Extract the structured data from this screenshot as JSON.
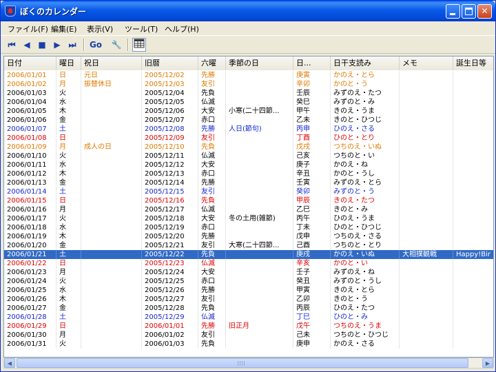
{
  "window": {
    "title": "ぼくのカレンダー"
  },
  "menu": [
    "ファイル(F)",
    "編集(E)",
    "表示(V)",
    "ツール(T)",
    "ヘルプ(H)"
  ],
  "toolbar": {
    "icons": [
      "first-icon",
      "prev-icon",
      "stop-icon",
      "next-icon",
      "last-icon",
      "go-icon",
      "settings-icon",
      "calendar-icon"
    ],
    "go_label": "Go"
  },
  "columns": [
    "日付",
    "曜日",
    "祝日",
    "旧暦",
    "六曜",
    "季節の日",
    "日...",
    "日干支読み",
    "メモ",
    "誕生日等"
  ],
  "colors": {
    "orange": "#e07a00",
    "blue": "#1428d0",
    "red": "#e00000",
    "selection": "#316ac5"
  },
  "rows": [
    {
      "date": "2006/01/01",
      "wd": "日",
      "hol": "元日",
      "old": "2005/12/02",
      "roku": "先勝",
      "season": "",
      "kanshi": "庚寅",
      "yomi": "かのえ・とら",
      "memo": "",
      "bday": "",
      "color": "orange"
    },
    {
      "date": "2006/01/02",
      "wd": "月",
      "hol": "振替休日",
      "old": "2005/12/03",
      "roku": "友引",
      "season": "",
      "kanshi": "辛卯",
      "yomi": "かのと・う",
      "memo": "",
      "bday": "",
      "color": "orange"
    },
    {
      "date": "2006/01/03",
      "wd": "火",
      "hol": "",
      "old": "2005/12/04",
      "roku": "先負",
      "season": "",
      "kanshi": "壬辰",
      "yomi": "みずのえ・たつ",
      "memo": "",
      "bday": "",
      "color": "black"
    },
    {
      "date": "2006/01/04",
      "wd": "水",
      "hol": "",
      "old": "2005/12/05",
      "roku": "仏滅",
      "season": "",
      "kanshi": "癸巳",
      "yomi": "みずのと・み",
      "memo": "",
      "bday": "",
      "color": "black"
    },
    {
      "date": "2006/01/05",
      "wd": "木",
      "hol": "",
      "old": "2005/12/06",
      "roku": "大安",
      "season": "小寒(二十四節...",
      "kanshi": "甲午",
      "yomi": "きのえ・うま",
      "memo": "",
      "bday": "",
      "color": "black"
    },
    {
      "date": "2006/01/06",
      "wd": "金",
      "hol": "",
      "old": "2005/12/07",
      "roku": "赤口",
      "season": "",
      "kanshi": "乙未",
      "yomi": "きのと・ひつじ",
      "memo": "",
      "bday": "",
      "color": "black"
    },
    {
      "date": "2006/01/07",
      "wd": "土",
      "hol": "",
      "old": "2005/12/08",
      "roku": "先勝",
      "season": "人日(節句)",
      "kanshi": "丙申",
      "yomi": "ひのえ・さる",
      "memo": "",
      "bday": "",
      "color": "blue"
    },
    {
      "date": "2006/01/08",
      "wd": "日",
      "hol": "",
      "old": "2005/12/09",
      "roku": "友引",
      "season": "",
      "kanshi": "丁酉",
      "yomi": "ひのと・とり",
      "memo": "",
      "bday": "",
      "color": "red"
    },
    {
      "date": "2006/01/09",
      "wd": "月",
      "hol": "成人の日",
      "old": "2005/12/10",
      "roku": "先負",
      "season": "",
      "kanshi": "戊戌",
      "yomi": "つちのえ・いぬ",
      "memo": "",
      "bday": "",
      "color": "orange"
    },
    {
      "date": "2006/01/10",
      "wd": "火",
      "hol": "",
      "old": "2005/12/11",
      "roku": "仏滅",
      "season": "",
      "kanshi": "己亥",
      "yomi": "つちのと・い",
      "memo": "",
      "bday": "",
      "color": "black"
    },
    {
      "date": "2006/01/11",
      "wd": "水",
      "hol": "",
      "old": "2005/12/12",
      "roku": "大安",
      "season": "",
      "kanshi": "庚子",
      "yomi": "かのえ・ね",
      "memo": "",
      "bday": "",
      "color": "black"
    },
    {
      "date": "2006/01/12",
      "wd": "木",
      "hol": "",
      "old": "2005/12/13",
      "roku": "赤口",
      "season": "",
      "kanshi": "辛丑",
      "yomi": "かのと・うし",
      "memo": "",
      "bday": "",
      "color": "black"
    },
    {
      "date": "2006/01/13",
      "wd": "金",
      "hol": "",
      "old": "2005/12/14",
      "roku": "先勝",
      "season": "",
      "kanshi": "壬寅",
      "yomi": "みずのえ・とら",
      "memo": "",
      "bday": "",
      "color": "black"
    },
    {
      "date": "2006/01/14",
      "wd": "土",
      "hol": "",
      "old": "2005/12/15",
      "roku": "友引",
      "season": "",
      "kanshi": "癸卯",
      "yomi": "みずのと・う",
      "memo": "",
      "bday": "",
      "color": "blue"
    },
    {
      "date": "2006/01/15",
      "wd": "日",
      "hol": "",
      "old": "2005/12/16",
      "roku": "先負",
      "season": "",
      "kanshi": "甲辰",
      "yomi": "きのえ・たつ",
      "memo": "",
      "bday": "",
      "color": "red"
    },
    {
      "date": "2006/01/16",
      "wd": "月",
      "hol": "",
      "old": "2005/12/17",
      "roku": "仏滅",
      "season": "",
      "kanshi": "乙巳",
      "yomi": "きのと・み",
      "memo": "",
      "bday": "",
      "color": "black"
    },
    {
      "date": "2006/01/17",
      "wd": "火",
      "hol": "",
      "old": "2005/12/18",
      "roku": "大安",
      "season": "冬の土用(雑節)",
      "kanshi": "丙午",
      "yomi": "ひのえ・うま",
      "memo": "",
      "bday": "",
      "color": "black"
    },
    {
      "date": "2006/01/18",
      "wd": "水",
      "hol": "",
      "old": "2005/12/19",
      "roku": "赤口",
      "season": "",
      "kanshi": "丁未",
      "yomi": "ひのと・ひつじ",
      "memo": "",
      "bday": "",
      "color": "black"
    },
    {
      "date": "2006/01/19",
      "wd": "木",
      "hol": "",
      "old": "2005/12/20",
      "roku": "先勝",
      "season": "",
      "kanshi": "戊申",
      "yomi": "つちのえ・さる",
      "memo": "",
      "bday": "",
      "color": "black"
    },
    {
      "date": "2006/01/20",
      "wd": "金",
      "hol": "",
      "old": "2005/12/21",
      "roku": "友引",
      "season": "大寒(二十四節...",
      "kanshi": "己酉",
      "yomi": "つちのと・とり",
      "memo": "",
      "bday": "",
      "color": "black"
    },
    {
      "date": "2006/01/21",
      "wd": "土",
      "hol": "",
      "old": "2005/12/22",
      "roku": "先負",
      "season": "",
      "kanshi": "庚戌",
      "yomi": "かのえ・いぬ",
      "memo": "大相撲観戦",
      "bday": "Happy!Bir",
      "color": "blue",
      "selected": true
    },
    {
      "date": "2006/01/22",
      "wd": "日",
      "hol": "",
      "old": "2005/12/23",
      "roku": "仏滅",
      "season": "",
      "kanshi": "辛亥",
      "yomi": "かのと・い",
      "memo": "",
      "bday": "",
      "color": "red"
    },
    {
      "date": "2006/01/23",
      "wd": "月",
      "hol": "",
      "old": "2005/12/24",
      "roku": "大安",
      "season": "",
      "kanshi": "壬子",
      "yomi": "みずのえ・ね",
      "memo": "",
      "bday": "",
      "color": "black"
    },
    {
      "date": "2006/01/24",
      "wd": "火",
      "hol": "",
      "old": "2005/12/25",
      "roku": "赤口",
      "season": "",
      "kanshi": "癸丑",
      "yomi": "みずのと・うし",
      "memo": "",
      "bday": "",
      "color": "black"
    },
    {
      "date": "2006/01/25",
      "wd": "水",
      "hol": "",
      "old": "2005/12/26",
      "roku": "先勝",
      "season": "",
      "kanshi": "甲寅",
      "yomi": "きのえ・とら",
      "memo": "",
      "bday": "",
      "color": "black"
    },
    {
      "date": "2006/01/26",
      "wd": "木",
      "hol": "",
      "old": "2005/12/27",
      "roku": "友引",
      "season": "",
      "kanshi": "乙卯",
      "yomi": "きのと・う",
      "memo": "",
      "bday": "",
      "color": "black"
    },
    {
      "date": "2006/01/27",
      "wd": "金",
      "hol": "",
      "old": "2005/12/28",
      "roku": "先負",
      "season": "",
      "kanshi": "丙辰",
      "yomi": "ひのえ・たつ",
      "memo": "",
      "bday": "",
      "color": "black"
    },
    {
      "date": "2006/01/28",
      "wd": "土",
      "hol": "",
      "old": "2005/12/29",
      "roku": "仏滅",
      "season": "",
      "kanshi": "丁巳",
      "yomi": "ひのと・み",
      "memo": "",
      "bday": "",
      "color": "blue"
    },
    {
      "date": "2006/01/29",
      "wd": "日",
      "hol": "",
      "old": "2006/01/01",
      "roku": "先勝",
      "season": "旧正月",
      "kanshi": "戊午",
      "yomi": "つちのえ・うま",
      "memo": "",
      "bday": "",
      "color": "red"
    },
    {
      "date": "2006/01/30",
      "wd": "月",
      "hol": "",
      "old": "2006/01/02",
      "roku": "友引",
      "season": "",
      "kanshi": "己未",
      "yomi": "つちのと・ひつじ",
      "memo": "",
      "bday": "",
      "color": "black"
    },
    {
      "date": "2006/01/31",
      "wd": "火",
      "hol": "",
      "old": "2006/01/03",
      "roku": "先負",
      "season": "",
      "kanshi": "庚申",
      "yomi": "かのえ・さる",
      "memo": "",
      "bday": "",
      "color": "black"
    }
  ]
}
